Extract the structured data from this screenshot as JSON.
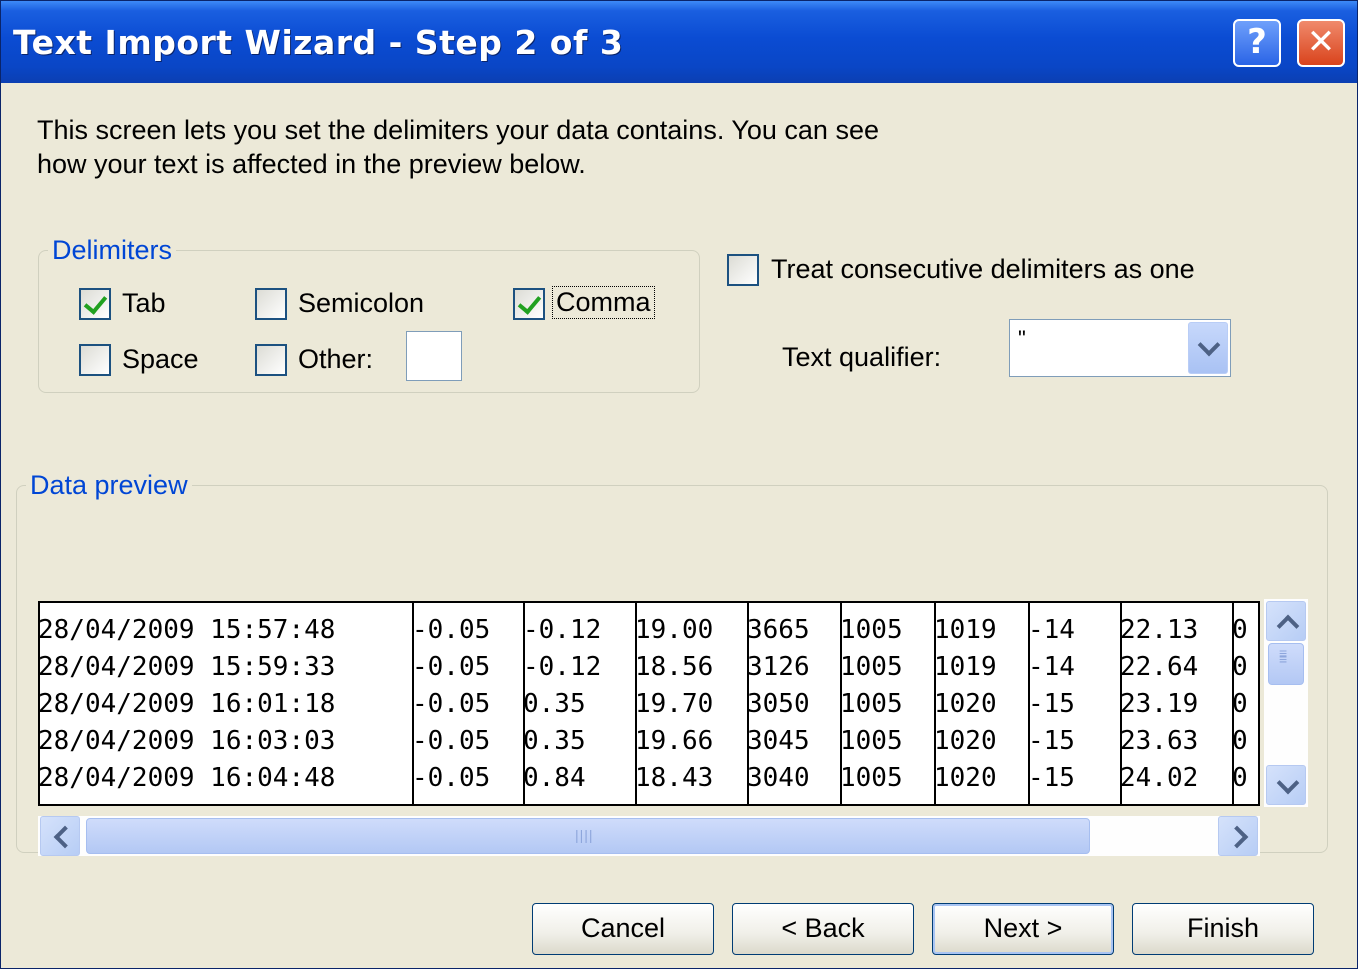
{
  "window": {
    "title": "Text Import Wizard - Step 2 of 3",
    "help_label": "?",
    "close_label": "✕"
  },
  "description": {
    "line1": "This screen lets you set the delimiters your data contains.  You can see",
    "line2": "how your text is affected in the preview below."
  },
  "delimiters": {
    "legend": "Delimiters",
    "tab": {
      "label": "Tab",
      "checked": true
    },
    "semicolon": {
      "label": "Semicolon",
      "checked": false
    },
    "comma": {
      "label": "Comma",
      "checked": true
    },
    "space": {
      "label": "Space",
      "checked": false
    },
    "other": {
      "label": "Other:",
      "checked": false,
      "value": ""
    }
  },
  "options": {
    "consecutive": {
      "label": "Treat consecutive delimiters as one",
      "checked": false
    },
    "qualifier_label": "Text qualifier:",
    "qualifier_value": "\""
  },
  "preview": {
    "legend": "Data preview",
    "rows": [
      [
        "28/04/2009 15:57:48",
        "-0.05",
        "-0.12",
        "19.00",
        "3665",
        "1005",
        "1019",
        "-14",
        "22.13",
        "0"
      ],
      [
        "28/04/2009 15:59:33",
        "-0.05",
        "-0.12",
        "18.56",
        "3126",
        "1005",
        "1019",
        "-14",
        "22.64",
        "0"
      ],
      [
        "28/04/2009 16:01:18",
        "-0.05",
        "0.35",
        "19.70",
        "3050",
        "1005",
        "1020",
        "-15",
        "23.19",
        "0"
      ],
      [
        "28/04/2009 16:03:03",
        "-0.05",
        "0.35",
        "19.66",
        "3045",
        "1005",
        "1020",
        "-15",
        "23.63",
        "0"
      ],
      [
        "28/04/2009 16:04:48",
        "-0.05",
        "0.84",
        "18.43",
        "3040",
        "1005",
        "1020",
        "-15",
        "24.02",
        "0"
      ]
    ]
  },
  "buttons": {
    "cancel": "Cancel",
    "back": "< Back",
    "next": "Next >",
    "finish": "Finish"
  },
  "colors": {
    "titlebar": "#0a46c6",
    "dialog_bg": "#ece9d8",
    "legend_text": "#0046d5",
    "check_mark": "#21a121"
  }
}
